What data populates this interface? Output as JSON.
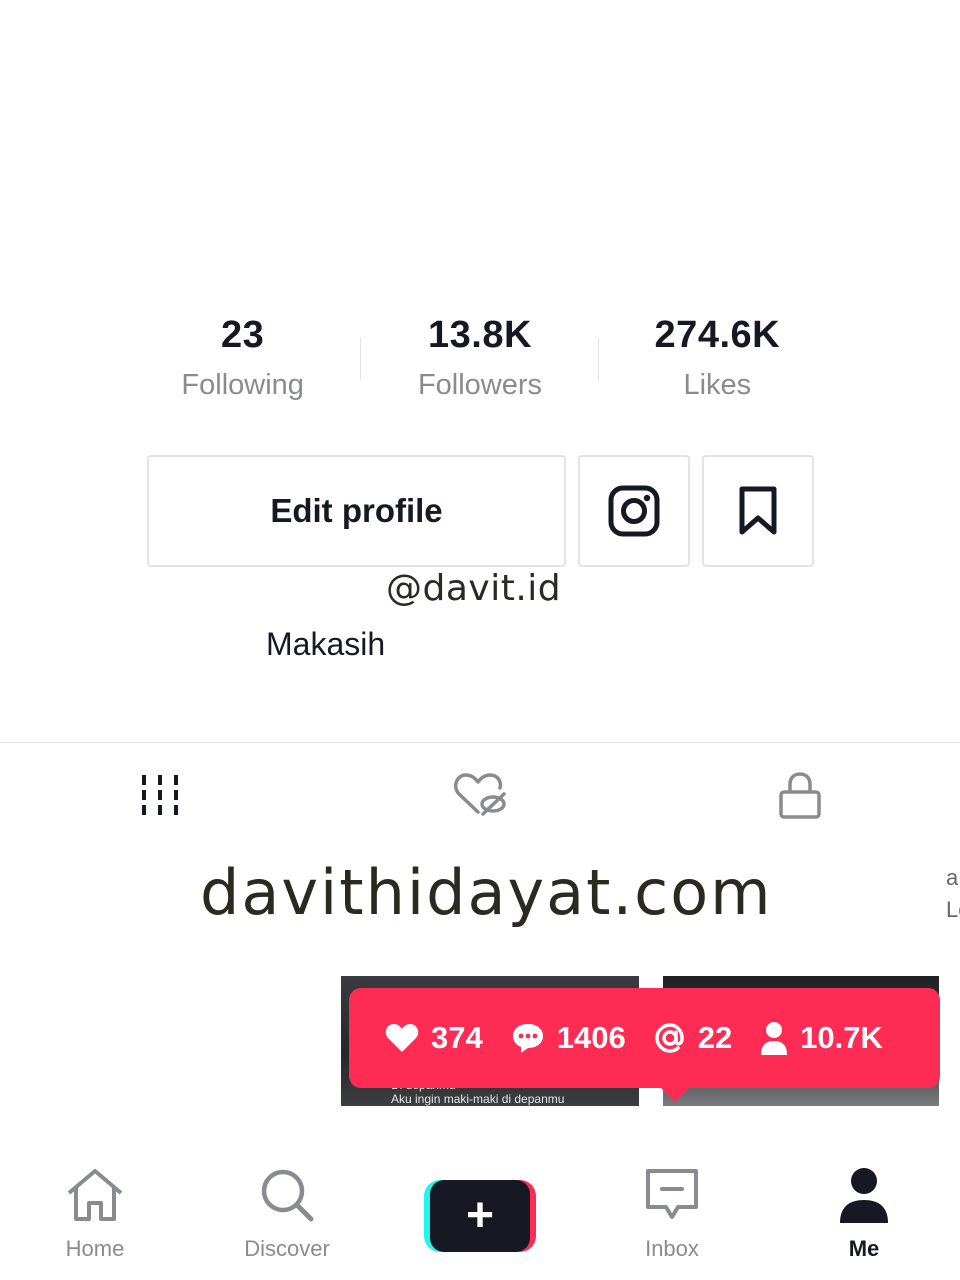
{
  "profile": {
    "stats": [
      {
        "value": "23",
        "label": "Following"
      },
      {
        "value": "13.8K",
        "label": "Followers"
      },
      {
        "value": "274.6K",
        "label": "Likes"
      }
    ],
    "edit_profile_label": "Edit profile",
    "bio": "Makasih"
  },
  "watermarks": {
    "handle": "@davit.id",
    "site": "davithidayat.com"
  },
  "edge_text": "a\nLo",
  "tabs": [
    {
      "icon": "grid-icon"
    },
    {
      "icon": "liked-hidden-icon"
    },
    {
      "icon": "lock-icon"
    }
  ],
  "thumbnail_caption": "Di depanmu\nAku ingin maki-maki di depanmu",
  "notification": {
    "likes": "374",
    "comments": "1406",
    "mentions": "22",
    "followers": "10.7K"
  },
  "bottom_nav": {
    "home": "Home",
    "discover": "Discover",
    "create_symbol": "+",
    "inbox": "Inbox",
    "me": "Me"
  },
  "colors": {
    "accent": "#fe2c55",
    "accent_cyan": "#25f4ee",
    "text_primary": "#161823",
    "text_secondary": "#8a8b91"
  }
}
